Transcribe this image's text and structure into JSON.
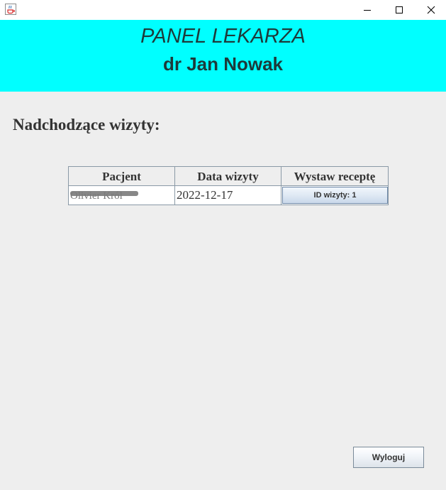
{
  "window": {
    "icon": "java-cup-icon",
    "minimize_glyph": "—",
    "close_glyph": "✕"
  },
  "header": {
    "title": "PANEL LEKARZA",
    "doctor": "dr Jan Nowak",
    "background_color": "#00ffff"
  },
  "main": {
    "section_heading": "Nadchodzące wizyty:"
  },
  "table": {
    "columns": [
      "Pacjent",
      "Data wizyty",
      "Wystaw receptę"
    ],
    "rows": [
      {
        "patient": "Olivier Król",
        "date": "2022-12-17",
        "action_label": "ID wizyty: 1"
      }
    ]
  },
  "footer": {
    "logout_label": "Wyloguj"
  }
}
